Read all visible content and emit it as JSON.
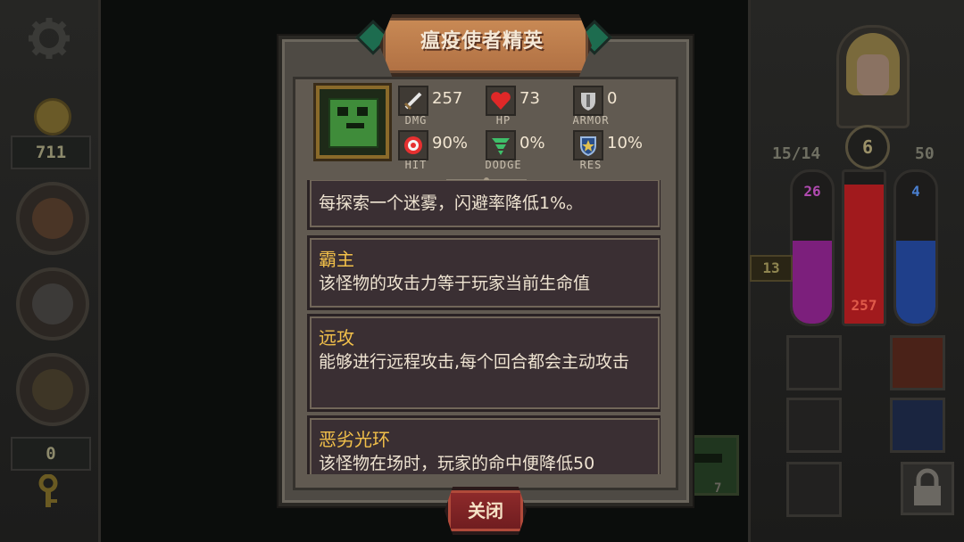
{
  "left_panel": {
    "gold": "711",
    "keys": "0"
  },
  "right_panel": {
    "level": "6",
    "exp": "15/14",
    "value_right": "50",
    "bars": [
      {
        "name": "mana",
        "value": "26",
        "color": "#9b2b9b"
      },
      {
        "name": "health",
        "value": "257",
        "color": "#b21f22"
      },
      {
        "name": "shield",
        "value": "4",
        "color": "#1f4fa0"
      }
    ],
    "floor": "13",
    "peek_count": "7"
  },
  "dialog": {
    "title": "瘟疫使者精英",
    "close_label": "关闭",
    "stats": [
      {
        "icon": "sword-icon",
        "value": "257",
        "label": "DMG"
      },
      {
        "icon": "heart-icon",
        "value": "73",
        "label": "HP"
      },
      {
        "icon": "shield-icon",
        "value": "0",
        "label": "ARMOR"
      },
      {
        "icon": "target-icon",
        "value": "90%",
        "label": "HIT"
      },
      {
        "icon": "tornado-icon",
        "value": "0%",
        "label": "DODGE"
      },
      {
        "icon": "resist-shield-icon",
        "value": "10%",
        "label": "RES"
      }
    ],
    "abilities": [
      {
        "title": "",
        "desc": "每探索一个迷雾，闪避率降低1%。"
      },
      {
        "title": "霸主",
        "desc": "该怪物的攻击力等于玩家当前生命值"
      },
      {
        "title": "远攻",
        "desc": "能够进行远程攻击,每个回合都会主动攻击"
      },
      {
        "title": "恶劣光环",
        "desc": "该怪物在场时，玩家的命中便降低50"
      }
    ]
  },
  "colors": {
    "ability_title": "#f2c04a",
    "title_banner": "#c98a55",
    "close_button": "#8f2b2b"
  }
}
